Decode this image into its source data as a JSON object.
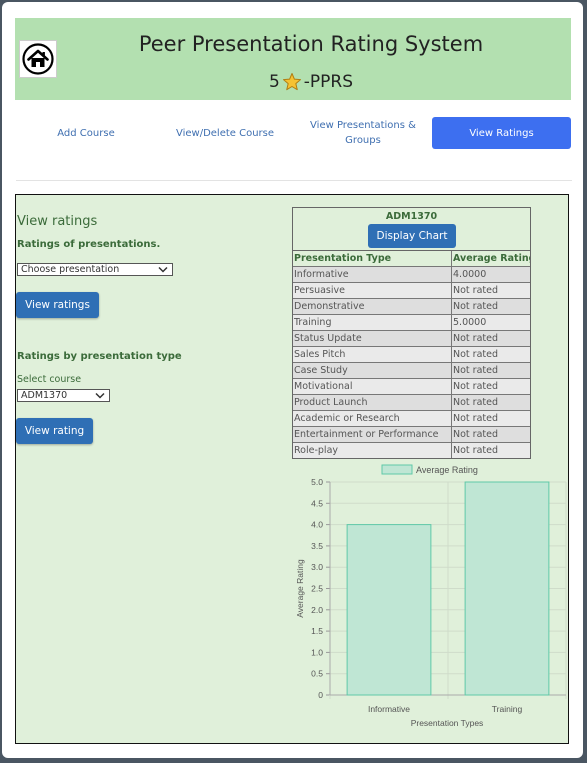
{
  "header": {
    "title": "Peer Presentation Rating System",
    "subtitle_prefix": "5",
    "subtitle_suffix": "-PPRS"
  },
  "nav": {
    "items": [
      {
        "label": "Add Course"
      },
      {
        "label": "View/Delete Course"
      },
      {
        "label": "View Presentations & Groups"
      },
      {
        "label": "View Ratings"
      }
    ]
  },
  "left": {
    "heading": "View ratings",
    "ratings_of_presentations": "Ratings of presentations.",
    "choose_presentation_value": "Choose presentation",
    "view_ratings_button": "View ratings",
    "ratings_by_type": "Ratings by presentation type",
    "select_course_label": "Select course",
    "course_value": "ADM1370",
    "view_rating_button": "View rating"
  },
  "table": {
    "course": "ADM1370",
    "display_chart_button": "Display Chart",
    "col_type": "Presentation Type",
    "col_avg": "Average Rating",
    "rows": [
      {
        "type": "Informative",
        "avg": "4.0000"
      },
      {
        "type": "Persuasive",
        "avg": "Not rated"
      },
      {
        "type": "Demonstrative",
        "avg": "Not rated"
      },
      {
        "type": "Training",
        "avg": "5.0000"
      },
      {
        "type": "Status Update",
        "avg": "Not rated"
      },
      {
        "type": "Sales Pitch",
        "avg": "Not rated"
      },
      {
        "type": "Case Study",
        "avg": "Not rated"
      },
      {
        "type": "Motivational",
        "avg": "Not rated"
      },
      {
        "type": "Product Launch",
        "avg": "Not rated"
      },
      {
        "type": "Academic or Research",
        "avg": "Not rated"
      },
      {
        "type": "Entertainment or Performance",
        "avg": "Not rated"
      },
      {
        "type": "Role-play",
        "avg": "Not rated"
      }
    ]
  },
  "chart_data": {
    "type": "bar",
    "categories": [
      "Informative",
      "Training"
    ],
    "series": [
      {
        "name": "Average Rating",
        "values": [
          4.0,
          5.0
        ]
      }
    ],
    "xlabel": "Presentation Types",
    "ylabel": "Average Rating",
    "ylim": [
      0,
      5
    ],
    "yticks": [
      "0",
      "0.5",
      "1.0",
      "1.5",
      "2.0",
      "2.5",
      "3.0",
      "3.5",
      "4.0",
      "4.5",
      "5.0"
    ],
    "legend": "top",
    "grid": true,
    "colors": {
      "fill": "#bfe6d4",
      "stroke": "#5fc9a8"
    }
  },
  "colors": {
    "header_bg": "#b3e0b0",
    "panel_bg": "#e0f0da",
    "accent": "#3d6ff0",
    "button": "#2f6fb5"
  }
}
